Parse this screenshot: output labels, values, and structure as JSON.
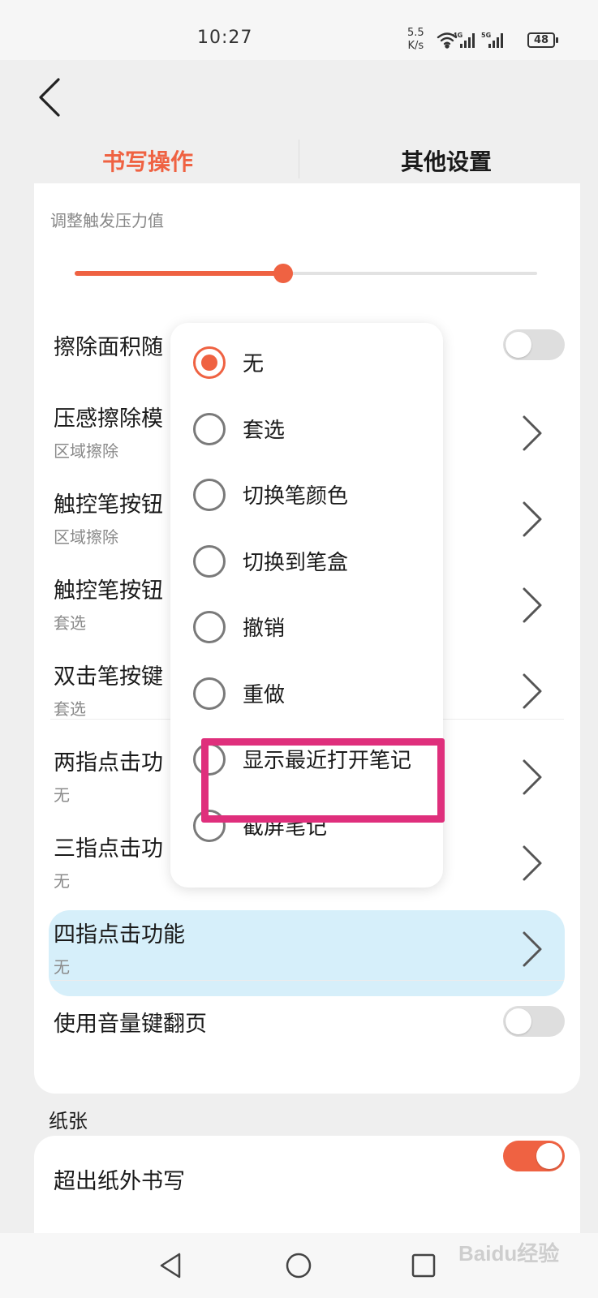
{
  "status_bar": {
    "time": "10:27",
    "speed_value": "5.5",
    "speed_unit": "K/s",
    "network_1": "4G",
    "network_2": "5G",
    "battery": "48"
  },
  "tabs": {
    "active": "书写操作",
    "other": "其他设置"
  },
  "pressure": {
    "caption": "调整触发压力值",
    "level_fraction": 0.45
  },
  "rows": [
    {
      "title": "擦除面积随",
      "type": "toggle",
      "on": false
    },
    {
      "title": "压感擦除模",
      "subtitle": "区域擦除",
      "type": "chevron"
    },
    {
      "title": "触控笔按钮",
      "subtitle": "区域擦除",
      "type": "chevron"
    },
    {
      "title": "触控笔按钮",
      "subtitle": "套选",
      "type": "chevron"
    },
    {
      "title": "双击笔按键",
      "subtitle": "套选",
      "type": "chevron"
    },
    {
      "title": "两指点击功",
      "subtitle": "无",
      "type": "chevron"
    },
    {
      "title": "三指点击功",
      "subtitle": "无",
      "type": "chevron"
    },
    {
      "title": "四指点击功能",
      "subtitle": "无",
      "type": "chevron",
      "highlighted": true
    },
    {
      "title": "使用音量键翻页",
      "type": "toggle",
      "on": false
    }
  ],
  "paper_section": {
    "label": "纸张",
    "first_item": "超出纸外书写",
    "first_item_on": true
  },
  "popup": {
    "options": [
      "无",
      "套选",
      "切换笔颜色",
      "切换到笔盒",
      "撤销",
      "重做",
      "显示最近打开笔记",
      "截屏笔记"
    ],
    "selected_index": 0,
    "annotated_index": 6
  },
  "watermark": "Baidu经验",
  "colors": {
    "accent": "#ef6242",
    "highlight": "#d6effa",
    "annotation": "#df2f7c"
  }
}
